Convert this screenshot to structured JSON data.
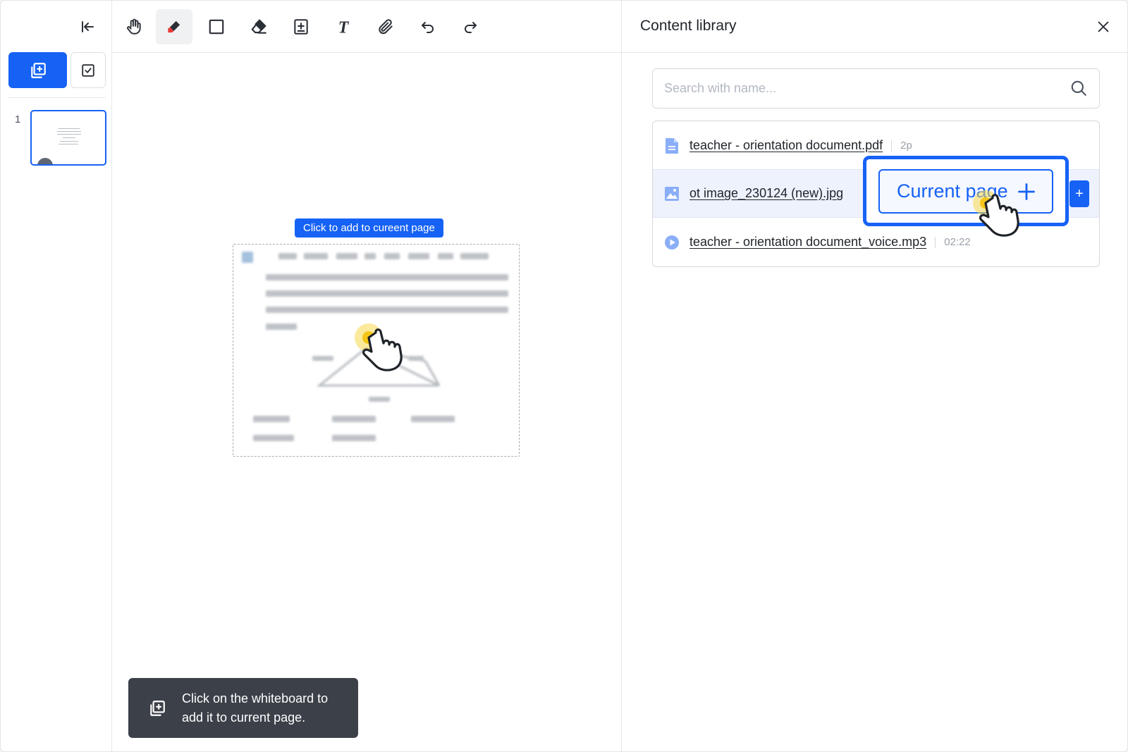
{
  "sidebar": {
    "page_number": "1"
  },
  "toolbar": {
    "tools": [
      "hand-tool",
      "pen-tool",
      "rectangle-tool",
      "eraser-tool",
      "add-content-tool",
      "text-tool",
      "attach-tool",
      "undo",
      "redo"
    ],
    "active_tool": "pen-tool"
  },
  "canvas": {
    "tooltip_label": "Click to add to cureent page",
    "toast_line1": "Click on the whiteboard to",
    "toast_line2": "add it to current page."
  },
  "panel": {
    "title": "Content library",
    "search": {
      "placeholder": "Search with name...",
      "value": ""
    },
    "files": [
      {
        "name": "teacher - orientation document.pdf",
        "meta": "2p",
        "type": "document-icon"
      },
      {
        "name": "ot image_230124 (new).jpg",
        "meta": "",
        "type": "image-icon"
      },
      {
        "name": "teacher - orientation document_voice.mp3",
        "meta": "02:22",
        "type": "audio-play-icon"
      }
    ],
    "mini_add_label": "+",
    "callout": {
      "current_page_label": "Current page"
    }
  },
  "colors": {
    "accent": "#1662f5",
    "toast_bg": "#3c4049",
    "hover_row": "#edf2fd",
    "cursor_highlight": "#f7d84a"
  }
}
